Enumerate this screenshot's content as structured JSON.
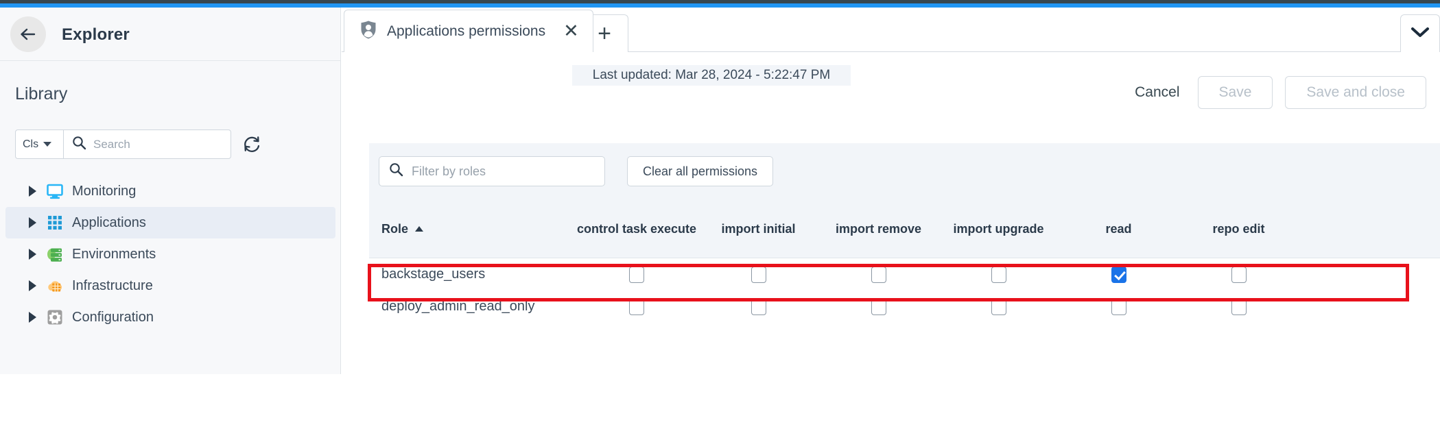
{
  "sidebar": {
    "title": "Explorer",
    "back_icon": "arrow-left-icon",
    "section_label": "Library",
    "search": {
      "scope_label": "Cls",
      "placeholder": "Search",
      "value": "",
      "search_icon": "search-icon",
      "refresh_icon": "refresh-icon"
    },
    "tree": [
      {
        "label": "Monitoring",
        "icon": "monitor-icon",
        "selected": false,
        "expanded": false
      },
      {
        "label": "Applications",
        "icon": "grid-apps-icon",
        "selected": true,
        "expanded": false
      },
      {
        "label": "Environments",
        "icon": "server-stack-icon",
        "selected": false,
        "expanded": false
      },
      {
        "label": "Infrastructure",
        "icon": "cloud-grid-icon",
        "selected": false,
        "expanded": false
      },
      {
        "label": "Configuration",
        "icon": "gear-icon",
        "selected": false,
        "expanded": false
      }
    ]
  },
  "tabs": {
    "active": {
      "label": "Applications permissions",
      "icon": "shield-user-icon",
      "close_icon": "close-icon"
    },
    "new_tab_icon": "plus-icon",
    "overflow_icon": "chevron-down-icon"
  },
  "header": {
    "last_updated": "Last updated: Mar 28, 2024 - 5:22:47 PM",
    "cancel_label": "Cancel",
    "save_label": "Save",
    "save_and_close_label": "Save and close"
  },
  "toolbar": {
    "filter_placeholder": "Filter by roles",
    "filter_value": "",
    "filter_icon": "search-icon",
    "clear_label": "Clear all permissions"
  },
  "table": {
    "columns": [
      "Role",
      "control task execute",
      "import initial",
      "import remove",
      "import upgrade",
      "read",
      "repo edit"
    ],
    "sort_column": "Role",
    "sort_direction": "asc",
    "rows": [
      {
        "role": "backstage_users",
        "permissions": [
          false,
          false,
          false,
          false,
          true,
          false
        ],
        "highlighted": true
      },
      {
        "role": "deploy_admin_read_only",
        "permissions": [
          false,
          false,
          false,
          false,
          false,
          false
        ],
        "highlighted": false
      }
    ],
    "row_menu_icon": "kebab-menu-icon"
  },
  "colors": {
    "accent_blue": "#2196f3",
    "checkbox_checked": "#1a73e8",
    "annotation_red": "#e8111b",
    "topbar_dark": "#37474f",
    "panel_grey": "#f2f5f9"
  }
}
